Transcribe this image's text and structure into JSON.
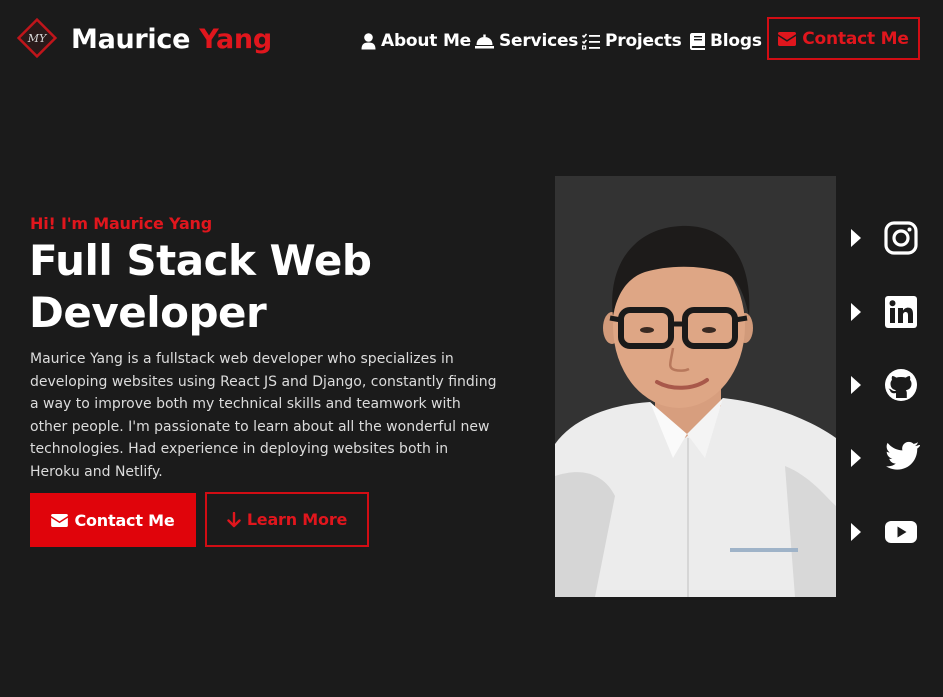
{
  "brand": {
    "first_name": "Maurice",
    "last_name": "Yang",
    "logo_initials": "MY"
  },
  "nav": {
    "items": [
      {
        "label": "About Me",
        "icon": "user-icon"
      },
      {
        "label": "Services",
        "icon": "bell-icon"
      },
      {
        "label": "Projects",
        "icon": "tasks-icon"
      },
      {
        "label": "Blogs",
        "icon": "book-icon"
      }
    ],
    "cta": {
      "label": "Contact Me",
      "icon": "envelope-icon"
    }
  },
  "hero": {
    "greeting": "Hi! I'm Maurice Yang",
    "title_line1": "Full Stack Web",
    "title_line2": "Developer",
    "bio": "Maurice Yang is a fullstack web developer who specializes in developing websites using React JS and Django, constantly finding a way to improve both my technical skills and teamwork with other people. I'm passionate to learn about all the wonderful new technologies. Had experience in deploying websites both in Heroku and Netlify.",
    "primary_button": {
      "label": "Contact Me",
      "icon": "envelope-icon"
    },
    "secondary_button": {
      "label": "Learn More",
      "icon": "arrow-down-icon"
    }
  },
  "social": [
    "instagram-icon",
    "linkedin-icon",
    "github-icon",
    "twitter-icon",
    "youtube-icon"
  ],
  "colors": {
    "background": "#1b1b1b",
    "accent": "#e0161d",
    "text": "#ffffff",
    "photo_background": "#333333"
  }
}
